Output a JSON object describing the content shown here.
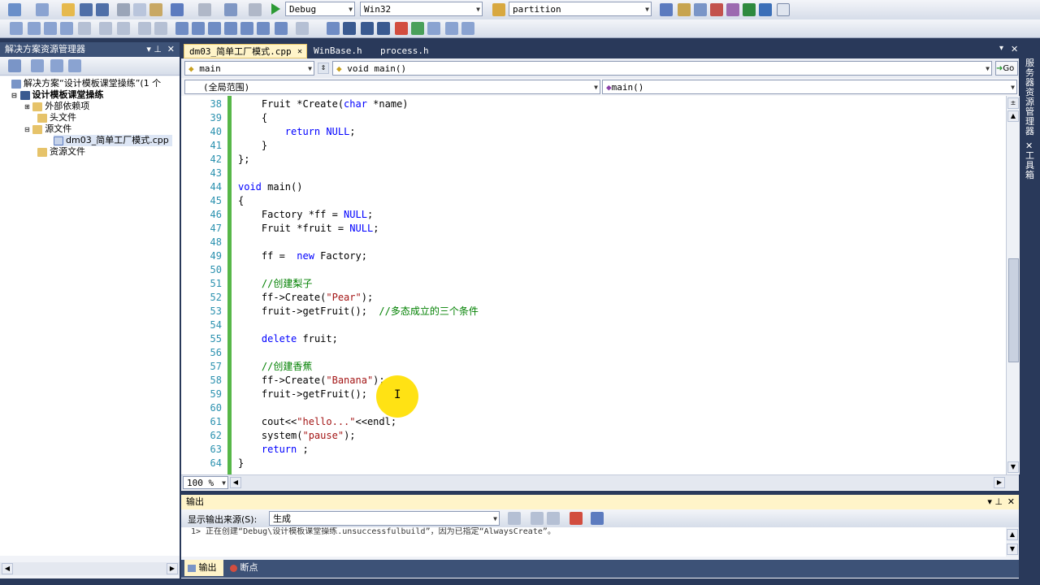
{
  "toolbar1": {
    "config": "Debug",
    "platform": "Win32",
    "find": "partition"
  },
  "solution_explorer": {
    "title": "解决方案资源管理器",
    "items": [
      {
        "label": "解决方案“设计模板课堂操练”(1 个"
      },
      {
        "label": "设计模板课堂操练"
      },
      {
        "label": "外部依赖项"
      },
      {
        "label": "头文件"
      },
      {
        "label": "源文件"
      },
      {
        "label": "dm03_简单工厂模式.cpp"
      },
      {
        "label": "资源文件"
      }
    ]
  },
  "editor": {
    "tabs": [
      {
        "label": "dm03_简单工厂模式.cpp",
        "close": "✕"
      },
      {
        "label": "WinBase.h"
      },
      {
        "label": "process.h"
      }
    ],
    "nav_left": "main",
    "nav_right": "void main()",
    "go_button": "Go",
    "scope_left": "(全局范围)",
    "scope_right": "main()",
    "zoom": "100 %",
    "lines": [
      {
        "n": "38",
        "code": "    Fruit *Create(char *name)"
      },
      {
        "n": "39",
        "code": "    {"
      },
      {
        "n": "40",
        "code": "        return NULL;"
      },
      {
        "n": "41",
        "code": "    }"
      },
      {
        "n": "42",
        "code": "};"
      },
      {
        "n": "43",
        "code": ""
      },
      {
        "n": "44",
        "code": "void main()"
      },
      {
        "n": "45",
        "code": "{"
      },
      {
        "n": "46",
        "code": "    Factory *ff = NULL;"
      },
      {
        "n": "47",
        "code": "    Fruit *fruit = NULL;"
      },
      {
        "n": "48",
        "code": ""
      },
      {
        "n": "49",
        "code": "    ff =  new Factory;"
      },
      {
        "n": "50",
        "code": ""
      },
      {
        "n": "51",
        "code": "    //创建梨子"
      },
      {
        "n": "52",
        "code": "    ff->Create(\"Pear\");"
      },
      {
        "n": "53",
        "code": "    fruit->getFruit();  //多态成立的三个条件"
      },
      {
        "n": "54",
        "code": ""
      },
      {
        "n": "55",
        "code": "    delete fruit;"
      },
      {
        "n": "56",
        "code": ""
      },
      {
        "n": "57",
        "code": "    //创建香蕉"
      },
      {
        "n": "58",
        "code": "    ff->Create(\"Banana\");"
      },
      {
        "n": "59",
        "code": "    fruit->getFruit();"
      },
      {
        "n": "60",
        "code": ""
      },
      {
        "n": "61",
        "code": "    cout<<\"hello...\"<<endl;"
      },
      {
        "n": "62",
        "code": "    system(\"pause\");"
      },
      {
        "n": "63",
        "code": "    return ;"
      },
      {
        "n": "64",
        "code": "}"
      }
    ]
  },
  "output": {
    "title": "输出",
    "source_label": "显示输出来源(S):",
    "source_value": "生成",
    "message": "1>  正在创建“Debug\\设计模板课堂操练.unsuccessfulbuild”，因为已指定“AlwaysCreate”。",
    "tabs": [
      "输出",
      "断点"
    ]
  },
  "right_sidebar": {
    "items": [
      "服务器资源管理器",
      "工具箱"
    ]
  },
  "colors": {
    "accent": "#ffe000",
    "line_number": "#2b91af",
    "keyword": "#0000ff",
    "string": "#a31515",
    "comment": "#008000",
    "frame": "#29395a"
  }
}
